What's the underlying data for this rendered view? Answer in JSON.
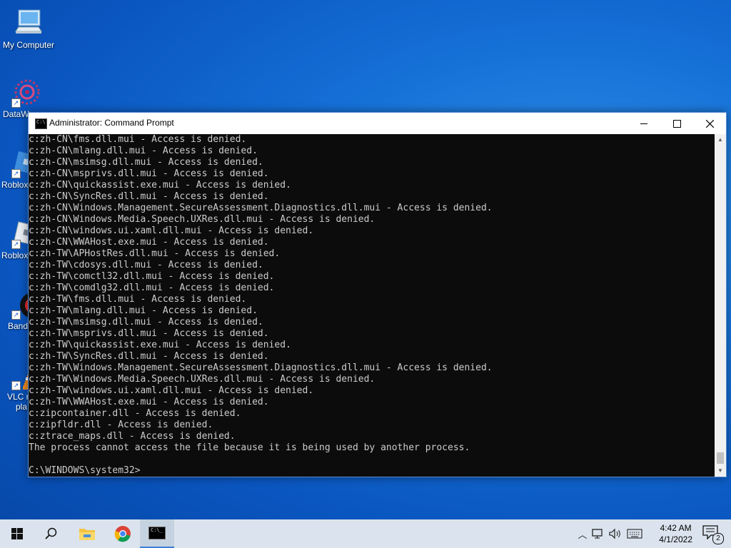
{
  "desktop": {
    "icons": [
      {
        "label": "My Computer",
        "icon": "computer-icon"
      },
      {
        "label": "DataW",
        "icon": "datawrapper-icon"
      },
      {
        "label": "Roblox",
        "icon": "roblox-icon"
      },
      {
        "label": "Roblox",
        "icon": "roblox-studio-icon"
      },
      {
        "label": "Band",
        "icon": "bandicam-icon"
      },
      {
        "label": "VLC m",
        "label2": "pla",
        "icon": "vlc-icon"
      }
    ]
  },
  "window": {
    "title": "Administrator: Command Prompt",
    "buttons": {
      "minimize": "minimize-icon",
      "maximize": "maximize-icon",
      "close": "close-icon"
    }
  },
  "console": {
    "lines": [
      "c:zh-CN\\fms.dll.mui - Access is denied.",
      "c:zh-CN\\mlang.dll.mui - Access is denied.",
      "c:zh-CN\\msimsg.dll.mui - Access is denied.",
      "c:zh-CN\\msprivs.dll.mui - Access is denied.",
      "c:zh-CN\\quickassist.exe.mui - Access is denied.",
      "c:zh-CN\\SyncRes.dll.mui - Access is denied.",
      "c:zh-CN\\Windows.Management.SecureAssessment.Diagnostics.dll.mui - Access is denied.",
      "c:zh-CN\\Windows.Media.Speech.UXRes.dll.mui - Access is denied.",
      "c:zh-CN\\windows.ui.xaml.dll.mui - Access is denied.",
      "c:zh-CN\\WWAHost.exe.mui - Access is denied.",
      "c:zh-TW\\APHostRes.dll.mui - Access is denied.",
      "c:zh-TW\\cdosys.dll.mui - Access is denied.",
      "c:zh-TW\\comctl32.dll.mui - Access is denied.",
      "c:zh-TW\\comdlg32.dll.mui - Access is denied.",
      "c:zh-TW\\fms.dll.mui - Access is denied.",
      "c:zh-TW\\mlang.dll.mui - Access is denied.",
      "c:zh-TW\\msimsg.dll.mui - Access is denied.",
      "c:zh-TW\\msprivs.dll.mui - Access is denied.",
      "c:zh-TW\\quickassist.exe.mui - Access is denied.",
      "c:zh-TW\\SyncRes.dll.mui - Access is denied.",
      "c:zh-TW\\Windows.Management.SecureAssessment.Diagnostics.dll.mui - Access is denied.",
      "c:zh-TW\\Windows.Media.Speech.UXRes.dll.mui - Access is denied.",
      "c:zh-TW\\windows.ui.xaml.dll.mui - Access is denied.",
      "c:zh-TW\\WWAHost.exe.mui - Access is denied.",
      "c:zipcontainer.dll - Access is denied.",
      "c:zipfldr.dll - Access is denied.",
      "c:ztrace_maps.dll - Access is denied.",
      "The process cannot access the file because it is being used by another process.",
      "",
      "C:\\WINDOWS\\system32>"
    ]
  },
  "taskbar": {
    "items": [
      "start-icon",
      "search-icon",
      "file-explorer-icon",
      "chrome-icon",
      "command-prompt-icon"
    ],
    "tray": [
      "chevron-up-icon",
      "network-icon",
      "volume-icon",
      "keyboard-icon"
    ],
    "time": "4:42 AM",
    "date": "4/1/2022",
    "notification_count": "2"
  },
  "colors": {
    "console_bg": "#0c0c0c",
    "console_fg": "#cccccc",
    "taskbar_bg": "#dbe4ee",
    "desktop": "#1570d6"
  }
}
